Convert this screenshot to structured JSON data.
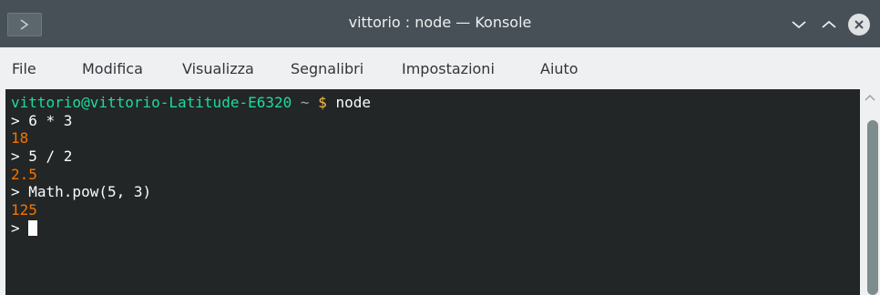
{
  "window": {
    "title": "vittorio : node — Konsole"
  },
  "menubar": {
    "items": [
      "File",
      "Modifica",
      "Visualizza",
      "Segnalibri",
      "Impostazioni",
      "Aiuto"
    ]
  },
  "terminal": {
    "prompt_user": "vittorio@vittorio-Latitude-E6320",
    "prompt_tilde": "~",
    "prompt_dollar": "$",
    "prompt_cmd": "node",
    "repl_lines": [
      {
        "input": "> 6 * 3",
        "output": "18"
      },
      {
        "input": "> 5 / 2",
        "output": "2.5"
      },
      {
        "input": "> Math.pow(5, 3)",
        "output": "125"
      }
    ],
    "current_prompt": ">"
  },
  "colors": {
    "titlebar": "#475057",
    "terminal_bg": "#232627",
    "prompt_user": "#1cdc9a",
    "prompt_dollar": "#fdbc4b",
    "output": "#f67400"
  },
  "icons": {
    "app": "konsole-icon",
    "minimize": "chevron-down-icon",
    "maximize": "chevron-up-icon",
    "close": "close-icon"
  }
}
